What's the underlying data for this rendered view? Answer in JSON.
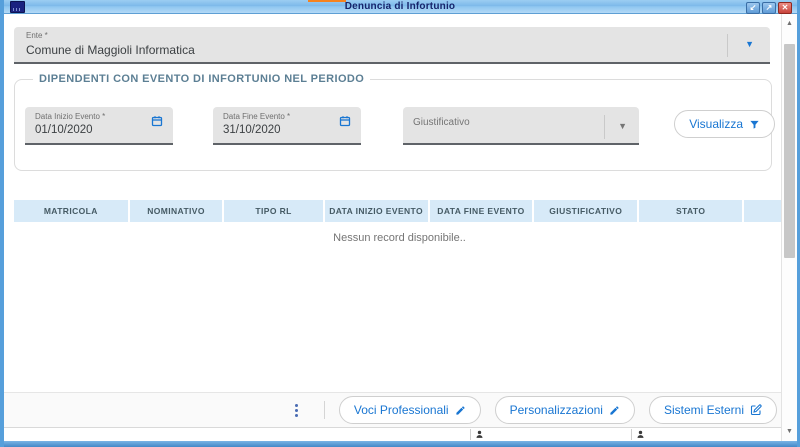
{
  "window": {
    "title": "Denuncia di Infortunio",
    "controls": {
      "restore": "↙",
      "maximize": "↗",
      "close": "✕"
    }
  },
  "ente": {
    "label": "Ente *",
    "value": "Comune di Maggioli Informatica",
    "dropdown_glyph": "▼"
  },
  "filters": {
    "legend": "DIPENDENTI CON EVENTO DI INFORTUNIO NEL PERIODO",
    "data_inizio": {
      "label": "Data Inizio Evento *",
      "value": "01/10/2020"
    },
    "data_fine": {
      "label": "Data Fine Evento *",
      "value": "31/10/2020"
    },
    "giustificativo": {
      "label": "Giustificativo",
      "dropdown_glyph": "▼"
    },
    "visualizza_label": "Visualizza"
  },
  "table": {
    "columns": [
      "MATRICOLA",
      "NOMINATIVO",
      "TIPO RL",
      "DATA INIZIO EVENTO",
      "DATA FINE EVENTO",
      "GIUSTIFICATIVO",
      "STATO",
      ""
    ],
    "empty_message": "Nessun record disponibile.."
  },
  "footer": {
    "buttons": [
      {
        "label": "Voci Professionali",
        "icon": "pencil-icon"
      },
      {
        "label": "Personalizzazioni",
        "icon": "pencil-icon"
      },
      {
        "label": "Sistemi Esterni",
        "icon": "edit-document-icon"
      }
    ]
  },
  "scrollbar": {
    "up_glyph": "▲",
    "down_glyph": "▼"
  },
  "colors": {
    "accent_blue": "#1976d2",
    "titlebar_blue": "#7db9ea",
    "title_text": "#16246b",
    "frame_blue": "#569fdb",
    "table_header_bg": "#d7eaf8",
    "legend_text": "#5c7f94",
    "field_bg": "#e4e4e4",
    "close_red": "#c8423a",
    "top_accent_orange": "#f5821f"
  }
}
